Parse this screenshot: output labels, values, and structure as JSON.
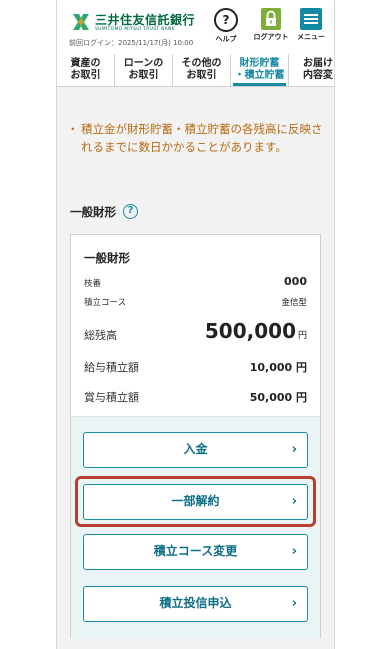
{
  "header": {
    "logo_text": "三井住友信託銀行",
    "logo_sub": "SUMITOMO MITSUI TRUST BANK",
    "last_login": "前回ログイン：2025/11/17(月) 10:00",
    "help_label": "ヘルプ",
    "logout_label": "ログアウト",
    "menu_label": "メニュー",
    "colors": {
      "brand": "#00693e",
      "logout": "#7fae3a",
      "menu": "#138aa4"
    }
  },
  "tabs": [
    {
      "line1": "資産の",
      "line2": "お取引"
    },
    {
      "line1": "ローンの",
      "line2": "お取引"
    },
    {
      "line1": "その他の",
      "line2": "お取引"
    },
    {
      "line1": "財形貯蓄",
      "line2": "・積立貯蓄",
      "active": true
    },
    {
      "line1": "お届け",
      "line2": "内容変"
    }
  ],
  "notice": {
    "bullet": "・",
    "text": "積立金が財形貯蓄・積立貯蓄の各残高に反映されるまでに数日かかることがあります。"
  },
  "section": {
    "title": "一般財形",
    "help_icon": "question-circle-icon"
  },
  "card": {
    "title": "一般財形",
    "branch_label": "枝番",
    "branch_value": "000",
    "course_label": "積立コース",
    "course_value": "金信型",
    "balance_label": "総残高",
    "balance_value": "500,000",
    "balance_unit": "円",
    "salary_label": "給与積立額",
    "salary_value": "10,000 円",
    "bonus_label": "賞与積立額",
    "bonus_value": "50,000 円"
  },
  "actions": {
    "deposit": "入金",
    "partial_withdrawal": "一部解約",
    "course_change": "積立コース変更",
    "investment_apply": "積立投信申込",
    "chevron": "›"
  },
  "accent_color": "#1a8aa3",
  "highlight_color": "#b5402e"
}
